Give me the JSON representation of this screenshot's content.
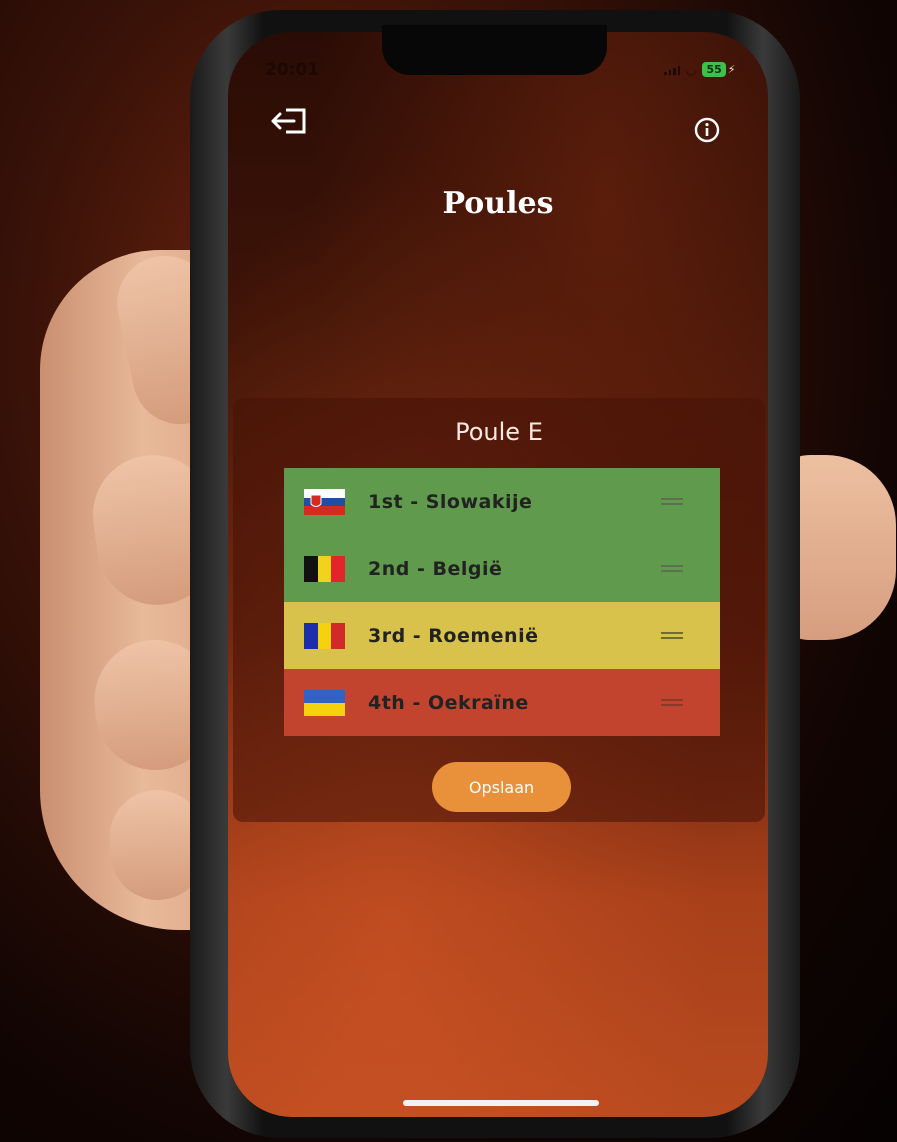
{
  "status_bar": {
    "time": "20:01",
    "battery": "55"
  },
  "header": {
    "title": "Poules"
  },
  "group": {
    "title": "Poule E",
    "rows": [
      {
        "label": "1st - Slowakije",
        "color": "#5f9a4d",
        "flag": "slovakia-flag-icon"
      },
      {
        "label": "2nd - België",
        "color": "#5f9a4d",
        "flag": "belgium-flag-icon"
      },
      {
        "label": "3rd - Roemenië",
        "color": "#d8c24c",
        "flag": "romania-flag-icon"
      },
      {
        "label": "4th - Oekraïne",
        "color": "#c2442e",
        "flag": "ukraine-flag-icon"
      }
    ],
    "save_label": "Opslaan"
  },
  "colors": {
    "accent": "#e8913a",
    "qualified": "#5f9a4d",
    "third": "#d8c24c",
    "eliminated": "#c2442e"
  }
}
